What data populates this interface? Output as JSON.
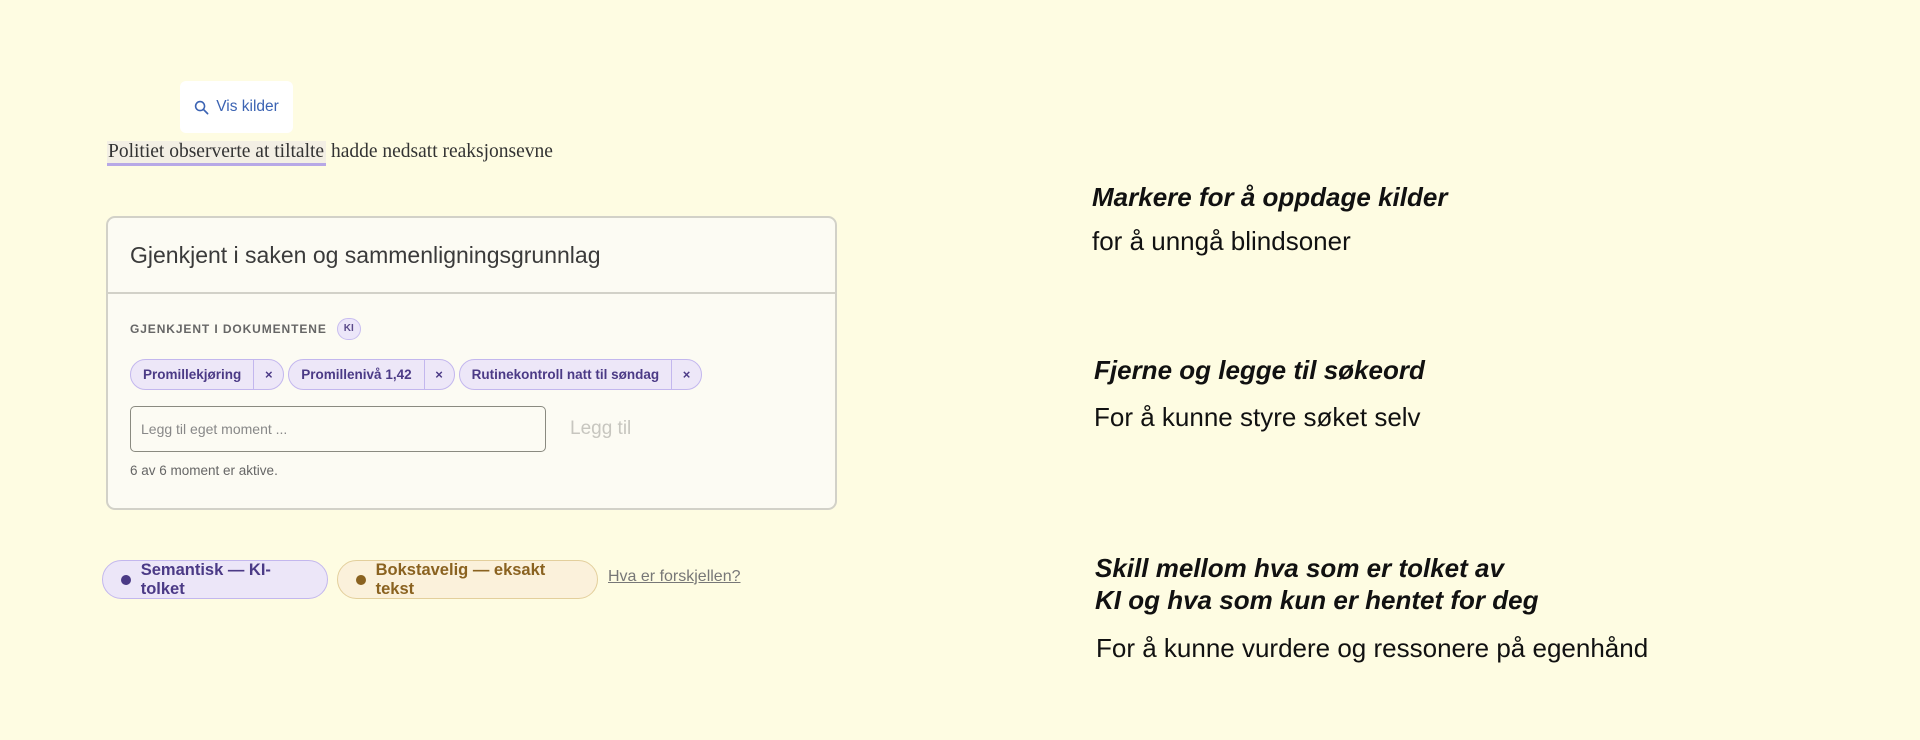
{
  "popup": {
    "label": "Vis kilder",
    "icon": "search-icon"
  },
  "sentence": {
    "highlighted": "Politiet observerte at tiltalte",
    "rest": " hadde nedsatt reaksjonsevne"
  },
  "card": {
    "title": "Gjenkjent i saken og sammenligningsgrunnlag",
    "section_label": "GJENKJENT I DOKUMENTENE",
    "badge": "KI",
    "chips": [
      {
        "label": "Promillekjøring",
        "remove": "×"
      },
      {
        "label": "Promillenivå 1,42",
        "remove": "×"
      },
      {
        "label": "Rutinekontroll natt til søndag",
        "remove": "×"
      }
    ],
    "input_placeholder": "Legg til eget moment ...",
    "add_label": "Legg til",
    "status": "6 av 6 moment er aktive."
  },
  "legend": {
    "semantic": "Semantisk — KI-tolket",
    "literal": "Bokstavelig — eksakt tekst",
    "link": "Hva er forskjellen?"
  },
  "notes": [
    {
      "title": "Markere for å oppdage kilder",
      "sub": "for å unngå blindsoner"
    },
    {
      "title": "Fjerne og legge til søkeord",
      "sub": "For å kunne styre søket selv"
    },
    {
      "title_line1": "Skill mellom hva som er tolket av",
      "title_line2": "KI og hva som kun er hentet for deg",
      "sub": "For å kunne vurdere og ressonere på egenhånd"
    }
  ],
  "colors": {
    "background": "#fefce2",
    "semantic_accent": "#4b3a86",
    "literal_accent": "#8a6220",
    "link_blue": "#3b63b3"
  }
}
